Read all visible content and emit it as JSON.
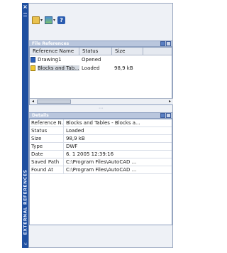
{
  "strip": {
    "close_glyph": "×",
    "title": "EXTERNAL REFERENCES",
    "footer_glyph": "⇲"
  },
  "toolbar": {
    "buttons": [
      {
        "icon": "attach-icon",
        "caret": "▾"
      },
      {
        "icon": "image-icon",
        "caret": "▾"
      },
      {
        "icon": "help-icon",
        "glyph": "?"
      }
    ]
  },
  "file_references": {
    "header": "File References",
    "columns": [
      "Reference Name",
      "Status",
      "Size"
    ],
    "rows": [
      {
        "name": "Drawing1",
        "status": "Opened",
        "size": ""
      },
      {
        "name": "Blocks and Tab...",
        "status": "Loaded",
        "size": "98,9 kB"
      }
    ],
    "scroll_left": "◂",
    "scroll_right": "▸"
  },
  "splitter_glyph": "⋯",
  "details": {
    "header": "Details",
    "rows": [
      {
        "key": "Reference N...",
        "value": "Blocks and Tables - Blocks a..."
      },
      {
        "key": "Status",
        "value": "Loaded"
      },
      {
        "key": "Size",
        "value": "98,9 kB"
      },
      {
        "key": "Type",
        "value": "DWF"
      },
      {
        "key": "Date",
        "value": "6. 1 2005 12:39:16"
      },
      {
        "key": "Saved Path",
        "value": "C:\\Program Files\\AutoCAD ..."
      },
      {
        "key": "Found At",
        "value": "C:\\Program Files\\AutoCAD ..."
      }
    ]
  }
}
